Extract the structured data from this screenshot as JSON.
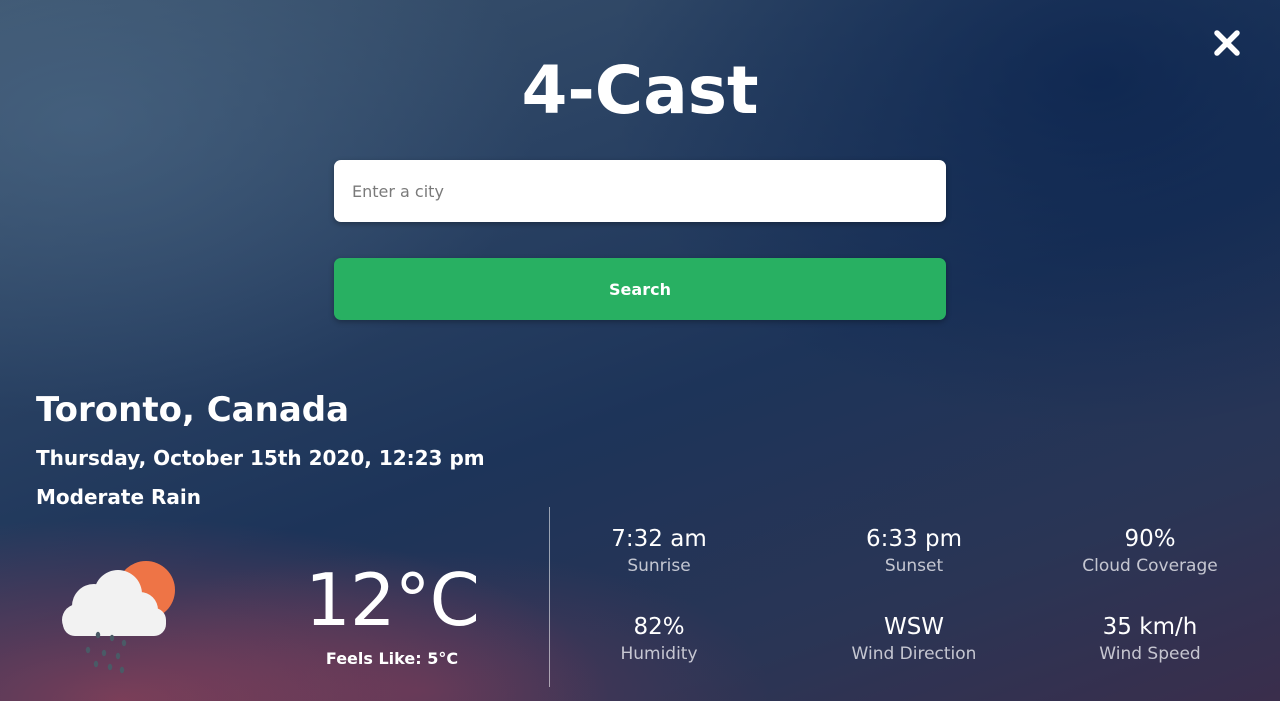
{
  "app": {
    "title": "4-Cast"
  },
  "header": {
    "close_icon": "close-icon"
  },
  "search": {
    "placeholder": "Enter a city",
    "value": "",
    "button_label": "Search"
  },
  "weather": {
    "location": "Toronto, Canada",
    "datetime": "Thursday, October 15th 2020, 12:23 pm",
    "condition": "Moderate Rain",
    "icon": "cloud-sun-rain-icon",
    "temperature": "12°C",
    "feels_like": "Feels Like: 5°C"
  },
  "stats": [
    {
      "value": "7:32 am",
      "label": "Sunrise"
    },
    {
      "value": "6:33 pm",
      "label": "Sunset"
    },
    {
      "value": "90%",
      "label": "Cloud Coverage"
    },
    {
      "value": "82%",
      "label": "Humidity"
    },
    {
      "value": "WSW",
      "label": "Wind Direction"
    },
    {
      "value": "35 km/h",
      "label": "Wind Speed"
    }
  ],
  "colors": {
    "search_button": "#28b062",
    "sun": "#ee7446",
    "cloud": "#f2f2f2",
    "rain": "#4a5a66"
  }
}
